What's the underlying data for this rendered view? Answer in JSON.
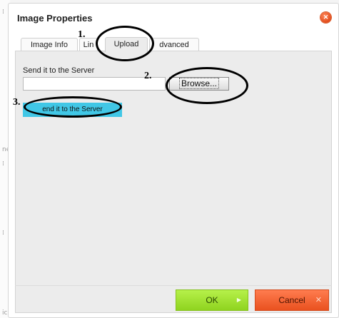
{
  "dialog": {
    "title": "Image Properties",
    "close_icon": "close-icon"
  },
  "tabs": [
    {
      "label": "Image Info",
      "active": false
    },
    {
      "label": "Lin",
      "active": false
    },
    {
      "label": "Upload",
      "active": true
    },
    {
      "label": "dvanced",
      "active": false
    }
  ],
  "upload": {
    "field_label": "Send it to the Server",
    "file_value": "",
    "browse_label": "Browse...",
    "send_label": "end it to the Server"
  },
  "footer": {
    "ok_label": "OK",
    "cancel_label": "Cancel",
    "ok_icon": "arrow-right-icon",
    "cancel_icon": "x-icon"
  },
  "annotations": {
    "step1": "1.",
    "step2": "2.",
    "step3": "3."
  },
  "background_fragments": {
    "frag1": "ne",
    "frag2": "ic"
  },
  "colors": {
    "ok_green": "#9ee02f",
    "cancel_orange": "#f25a25",
    "send_cyan": "#41c7e6",
    "close_orange": "#e24b1b"
  }
}
